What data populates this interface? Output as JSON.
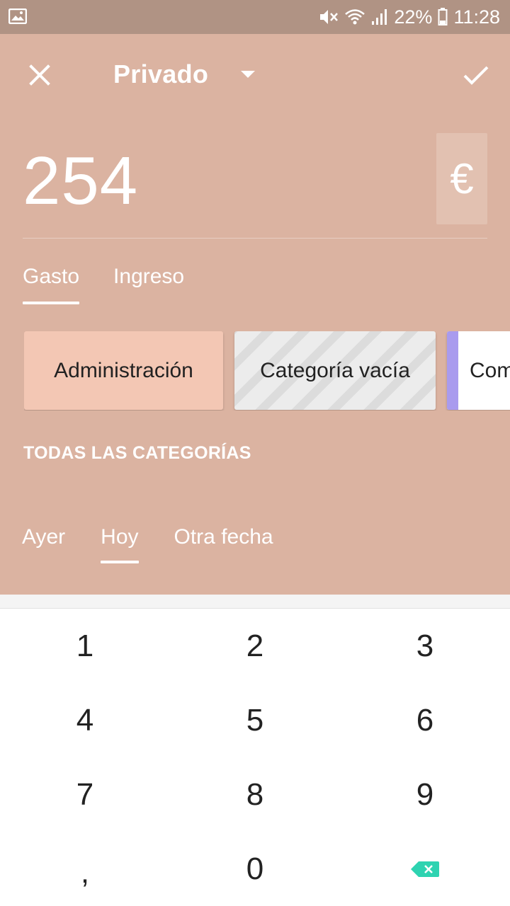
{
  "status_bar": {
    "battery": "22%",
    "time": "11:28"
  },
  "header": {
    "account": "Privado"
  },
  "amount": {
    "value": "254",
    "currency": "€"
  },
  "type_tabs": [
    {
      "label": "Gasto",
      "active": true
    },
    {
      "label": "Ingreso",
      "active": false
    }
  ],
  "categories": [
    {
      "label": "Administración"
    },
    {
      "label": "Categoría vacía"
    },
    {
      "label": "Com"
    }
  ],
  "all_categories_label": "TODAS LAS CATEGORÍAS",
  "date_tabs": [
    {
      "label": "Ayer",
      "active": false
    },
    {
      "label": "Hoy",
      "active": true
    },
    {
      "label": "Otra fecha",
      "active": false
    }
  ],
  "keypad": {
    "keys": [
      "1",
      "2",
      "3",
      "4",
      "5",
      "6",
      "7",
      "8",
      "9",
      ",",
      "0"
    ]
  },
  "colors": {
    "primary": "#dbb3a1",
    "status_bar": "#b09384",
    "category_selected": "#f3c7b4",
    "category_accent": "#a99bee",
    "backspace": "#2ed3b1"
  },
  "icons": {
    "close": "close-icon",
    "check": "check-icon",
    "caret": "caret-down-icon",
    "backspace": "backspace-icon"
  }
}
